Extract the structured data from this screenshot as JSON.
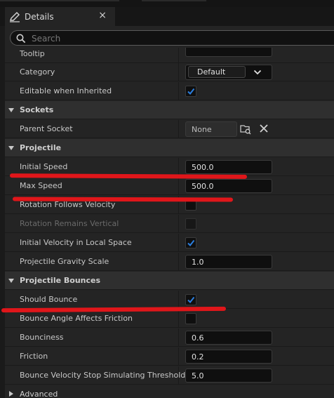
{
  "tab": {
    "title": "Details",
    "close_glyph": "×"
  },
  "search": {
    "placeholder": "Search"
  },
  "rows": {
    "tooltip": {
      "label": "Tooltip"
    },
    "category": {
      "label": "Category",
      "value": "Default"
    },
    "editable_inherited": {
      "label": "Editable when Inherited",
      "checked": true
    },
    "sockets_header": {
      "label": "Sockets"
    },
    "parent_socket": {
      "label": "Parent Socket",
      "value": "None"
    },
    "projectile_header": {
      "label": "Projectile"
    },
    "initial_speed": {
      "label": "Initial Speed",
      "value": "500.0"
    },
    "max_speed": {
      "label": "Max Speed",
      "value": "500.0"
    },
    "rotation_follows": {
      "label": "Rotation Follows Velocity",
      "checked": false
    },
    "rotation_vertical": {
      "label": "Rotation Remains Vertical",
      "checked": false,
      "disabled": true
    },
    "initial_velocity_local": {
      "label": "Initial Velocity in Local Space",
      "checked": true
    },
    "gravity_scale": {
      "label": "Projectile Gravity Scale",
      "value": "1.0"
    },
    "bounces_header": {
      "label": "Projectile Bounces"
    },
    "should_bounce": {
      "label": "Should Bounce",
      "checked": true
    },
    "bounce_angle_friction": {
      "label": "Bounce Angle Affects Friction",
      "checked": false
    },
    "bounciness": {
      "label": "Bounciness",
      "value": "0.6"
    },
    "friction": {
      "label": "Friction",
      "value": "0.2"
    },
    "bounce_stop_threshold": {
      "label": "Bounce Velocity Stop Simulating Threshold",
      "value": "5.0"
    },
    "advanced": {
      "label": "Advanced"
    }
  },
  "colors": {
    "checkmark": "#2b7fe0",
    "annotation_red": "#e0161a",
    "panel_bg": "#242424",
    "category_bg": "#2f2f2f"
  },
  "icons": {
    "tab": "pencil-icon",
    "search": "search-icon",
    "combo": "chevron-down-icon",
    "socket_browse": "folder-search-icon",
    "socket_clear": "close-icon",
    "category_expand": "caret-down-icon",
    "category_collapsed": "caret-right-icon"
  }
}
